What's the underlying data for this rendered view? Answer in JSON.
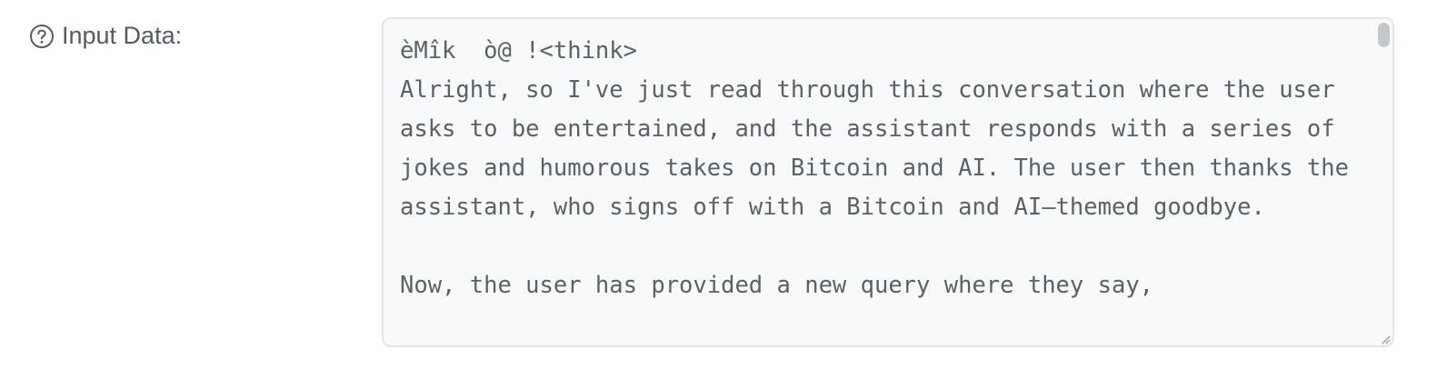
{
  "field": {
    "label": "Input Data:",
    "help_icon": "question-circle-icon",
    "value": "èMîk  ò@ !<think>\nAlright, so I've just read through this conversation where the user asks to be entertained, and the assistant responds with a series of jokes and humorous takes on Bitcoin and AI. The user then thanks the assistant, who signs off with a Bitcoin and AI–themed goodbye.\n\nNow, the user has provided a new query where they say,"
  },
  "colors": {
    "label": "#555b63",
    "text": "#5b6169",
    "border": "#e3e6ea",
    "background": "#f8f9fa"
  }
}
